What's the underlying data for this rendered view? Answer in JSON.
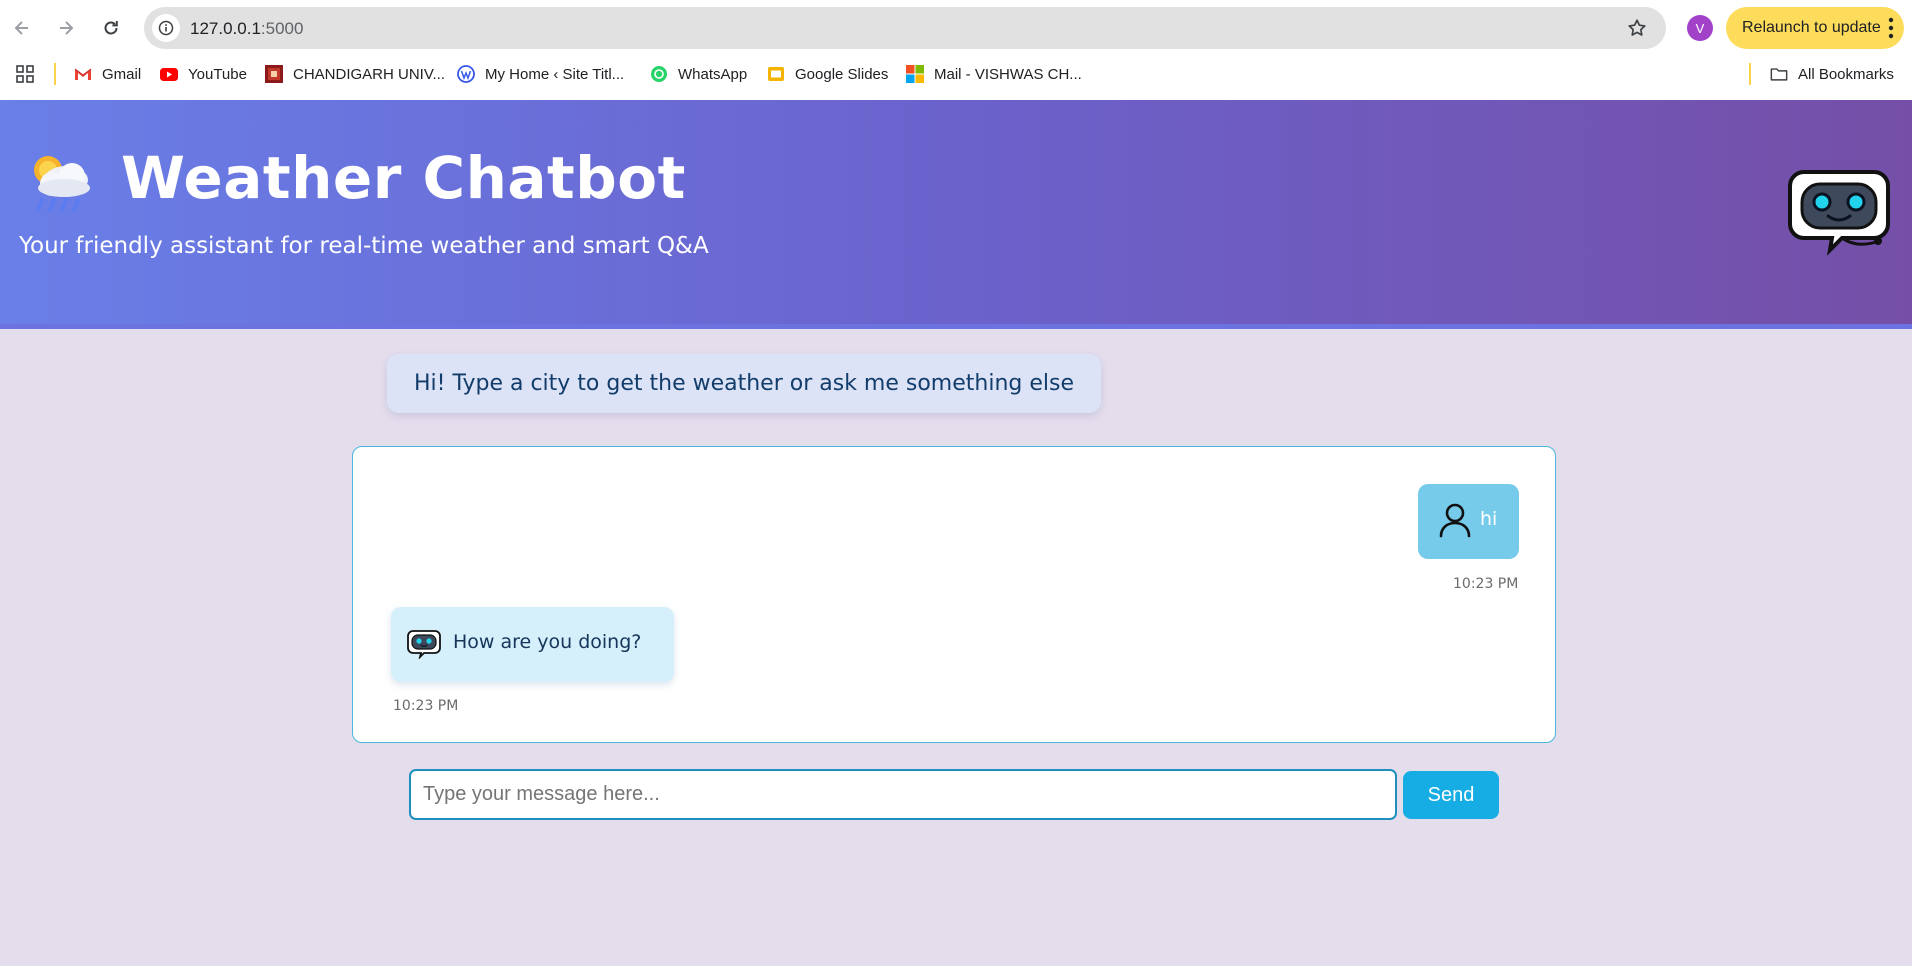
{
  "browser": {
    "url_host": "127.0.0.1",
    "url_port": ":5000",
    "profile_initial": "V",
    "relaunch_label": "Relaunch to update",
    "all_bookmarks_label": "All Bookmarks",
    "bookmarks": [
      {
        "label": "Gmail",
        "icon": "gmail-icon"
      },
      {
        "label": "YouTube",
        "icon": "youtube-icon"
      },
      {
        "label": "CHANDIGARH UNIV...",
        "icon": "chandigarh-university-icon"
      },
      {
        "label": "My Home ‹ Site Titl...",
        "icon": "wordpress-icon"
      },
      {
        "label": "WhatsApp",
        "icon": "whatsapp-icon"
      },
      {
        "label": "Google Slides",
        "icon": "google-slides-icon"
      },
      {
        "label": "Mail - VISHWAS CH...",
        "icon": "microsoft-icon"
      }
    ]
  },
  "header": {
    "title": "Weather Chatbot",
    "subtitle": "Your friendly assistant for real-time weather and smart Q&A",
    "icon": "weather-cloud-icon",
    "logo": "robot-chat-icon"
  },
  "greeting": "Hi! Type a city to get the weather or ask me something else",
  "chat": {
    "messages": [
      {
        "sender": "user",
        "text": "hi",
        "time": "10:23 PM"
      },
      {
        "sender": "bot",
        "text": "How are you doing?",
        "time": "10:23 PM"
      }
    ]
  },
  "input": {
    "placeholder": "Type your message here...",
    "send_label": "Send"
  },
  "colors": {
    "header_gradient_start": "#6a7fe8",
    "header_gradient_end": "#754fa7",
    "user_bubble": "#76cbeb",
    "bot_bubble": "#d5effb",
    "send_button": "#16ade5"
  }
}
